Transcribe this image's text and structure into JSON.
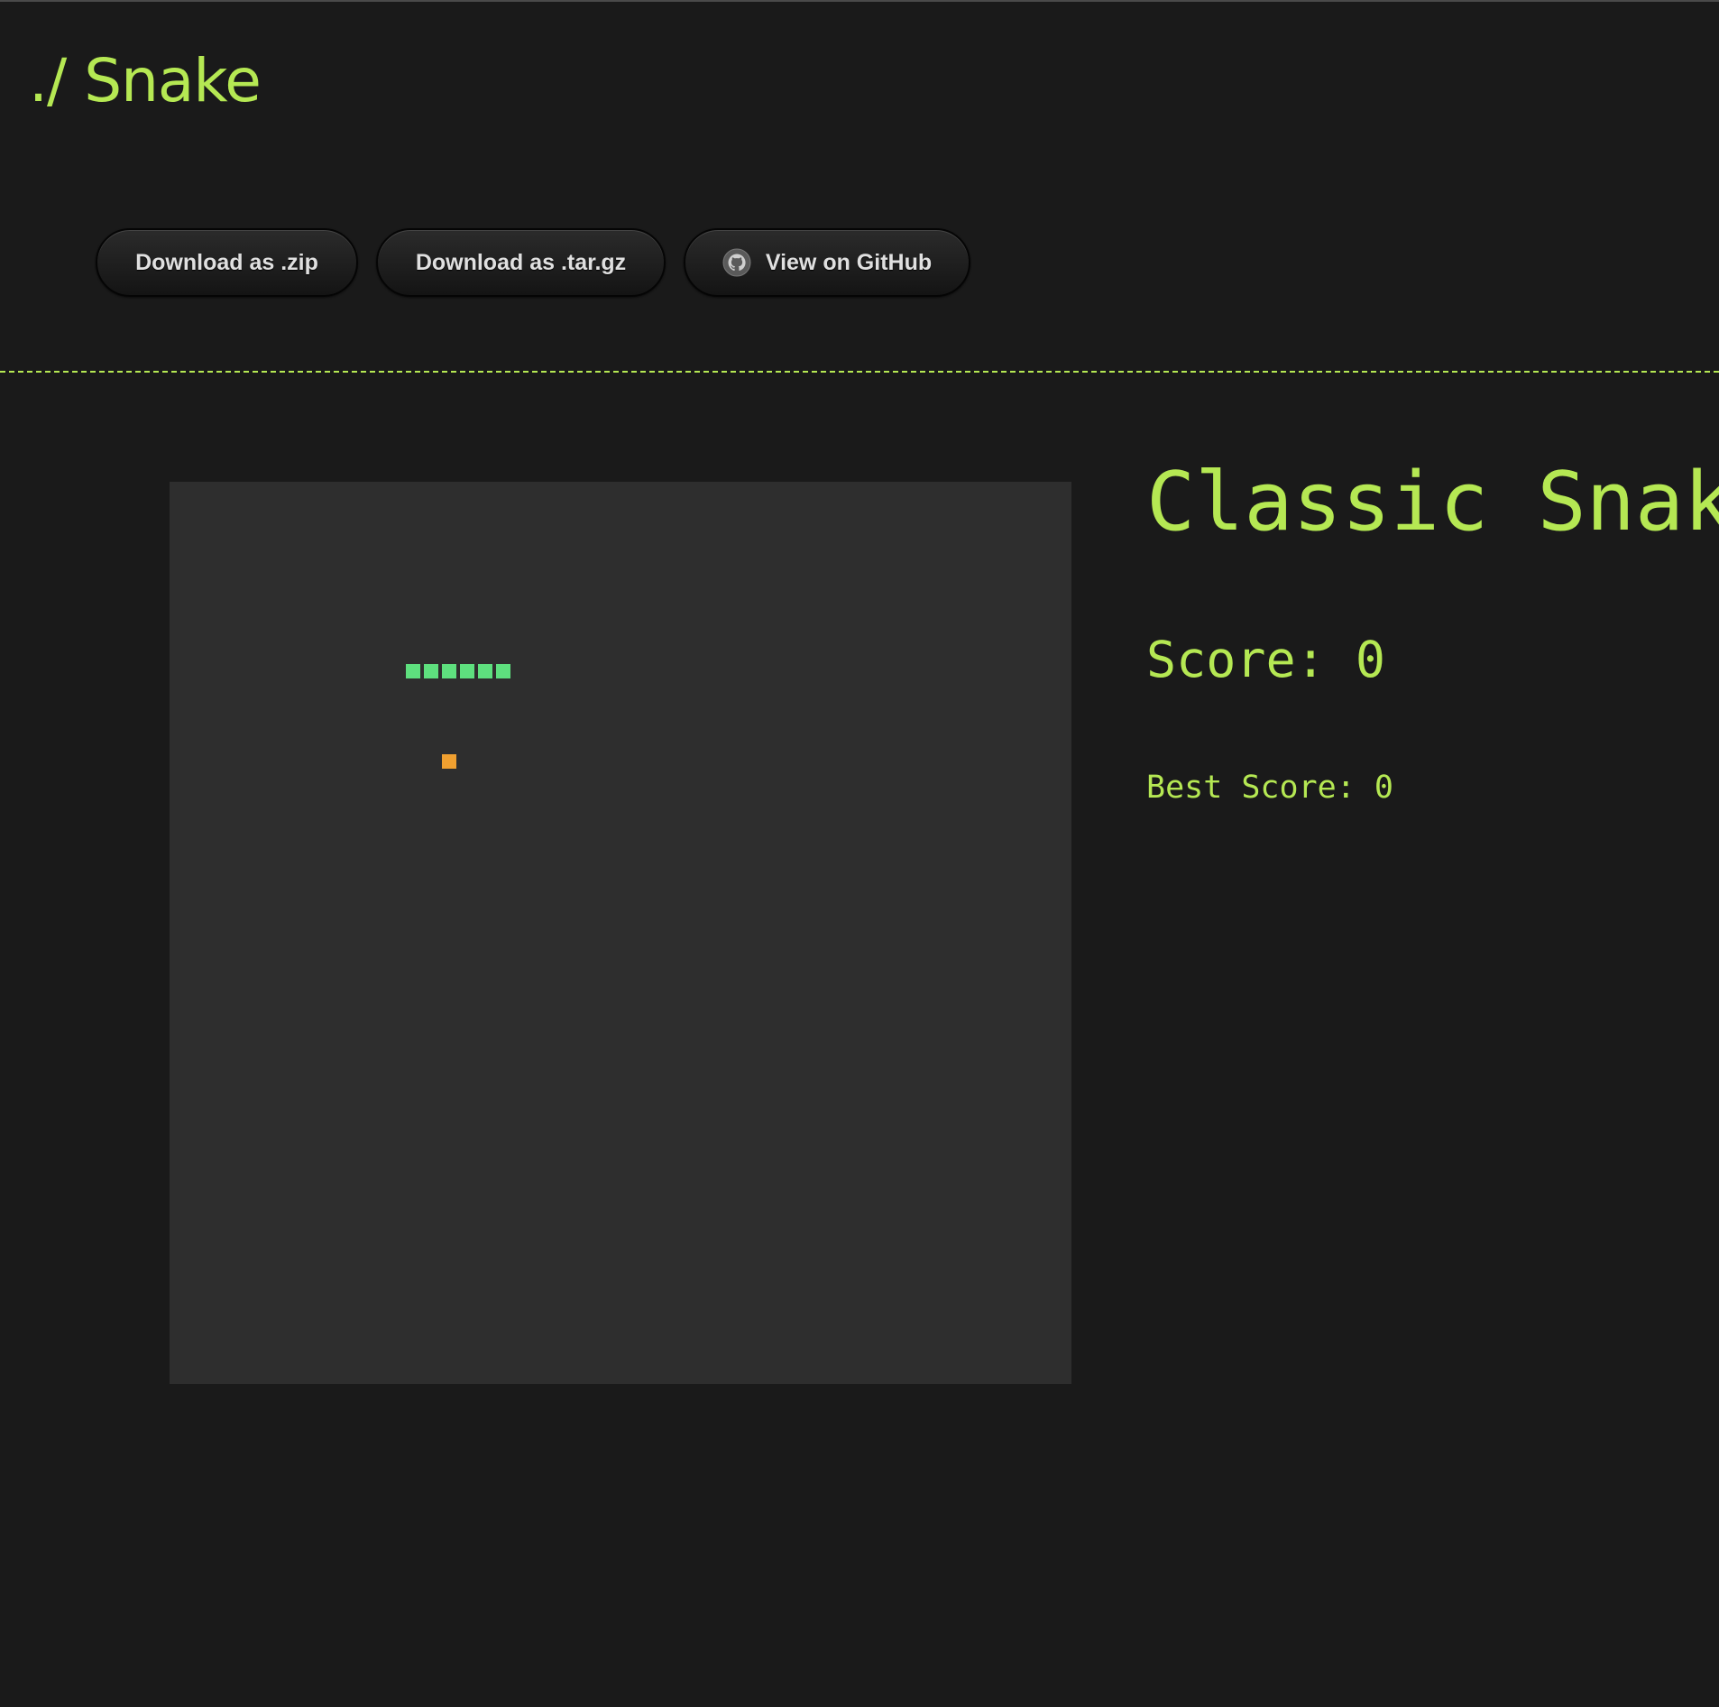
{
  "header": {
    "title": "./ Snake"
  },
  "downloads": {
    "zip_label": "Download as .zip",
    "tar_label": "Download as .tar.gz",
    "github_label": "View on GitHub",
    "github_icon": "github-icon"
  },
  "game": {
    "title": "Classic Snake",
    "score_label": "Score:",
    "score": 0,
    "best_score_label": "Best Score:",
    "best_score": 0,
    "grid_size": 50,
    "snake_color": "#5ee07e",
    "food_color": "#f0a030",
    "snake": [
      {
        "col": 13,
        "row": 10
      },
      {
        "col": 14,
        "row": 10
      },
      {
        "col": 15,
        "row": 10
      },
      {
        "col": 16,
        "row": 10
      },
      {
        "col": 17,
        "row": 10
      },
      {
        "col": 18,
        "row": 10
      }
    ],
    "food": {
      "col": 15,
      "row": 15
    }
  },
  "colors": {
    "background": "#1a1a1a",
    "board": "#2e2e2e",
    "accent": "#b5e853"
  }
}
